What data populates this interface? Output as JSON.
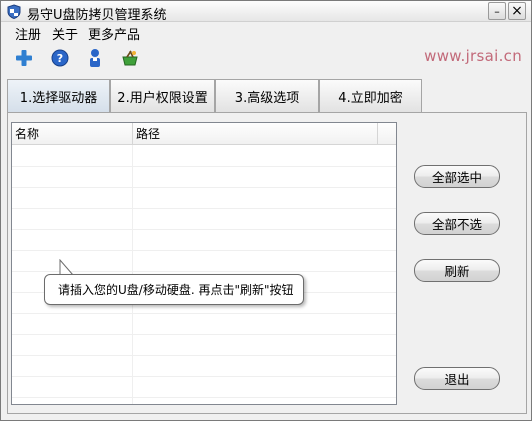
{
  "window": {
    "title": "易守U盘防拷贝管理系统",
    "minimize_symbol": "–",
    "close_symbol": "×"
  },
  "menu": {
    "items": [
      "注册",
      "关于",
      "更多产品"
    ]
  },
  "toolbar": {
    "buttons": [
      "add-icon",
      "help-icon",
      "user-icon",
      "basket-icon"
    ]
  },
  "watermark": "www.jrsai.cn",
  "tabs": [
    {
      "label": "1.选择驱动器",
      "active": true
    },
    {
      "label": "2.用户权限设置",
      "active": false
    },
    {
      "label": "3.高级选项",
      "active": false
    },
    {
      "label": "4.立即加密",
      "active": false
    }
  ],
  "drive_list": {
    "columns": [
      "名称",
      "路径"
    ],
    "rows": []
  },
  "buttons": {
    "select_all": "全部选中",
    "deselect_all": "全部不选",
    "refresh": "刷新",
    "exit": "退出"
  },
  "tooltip": "请插入您的U盘/移动硬盘. 再点击\"刷新\"按钮",
  "colors": {
    "watermark": "#c26a7a",
    "window_bg": "#f0f0f0",
    "border": "#7a7a7a"
  }
}
